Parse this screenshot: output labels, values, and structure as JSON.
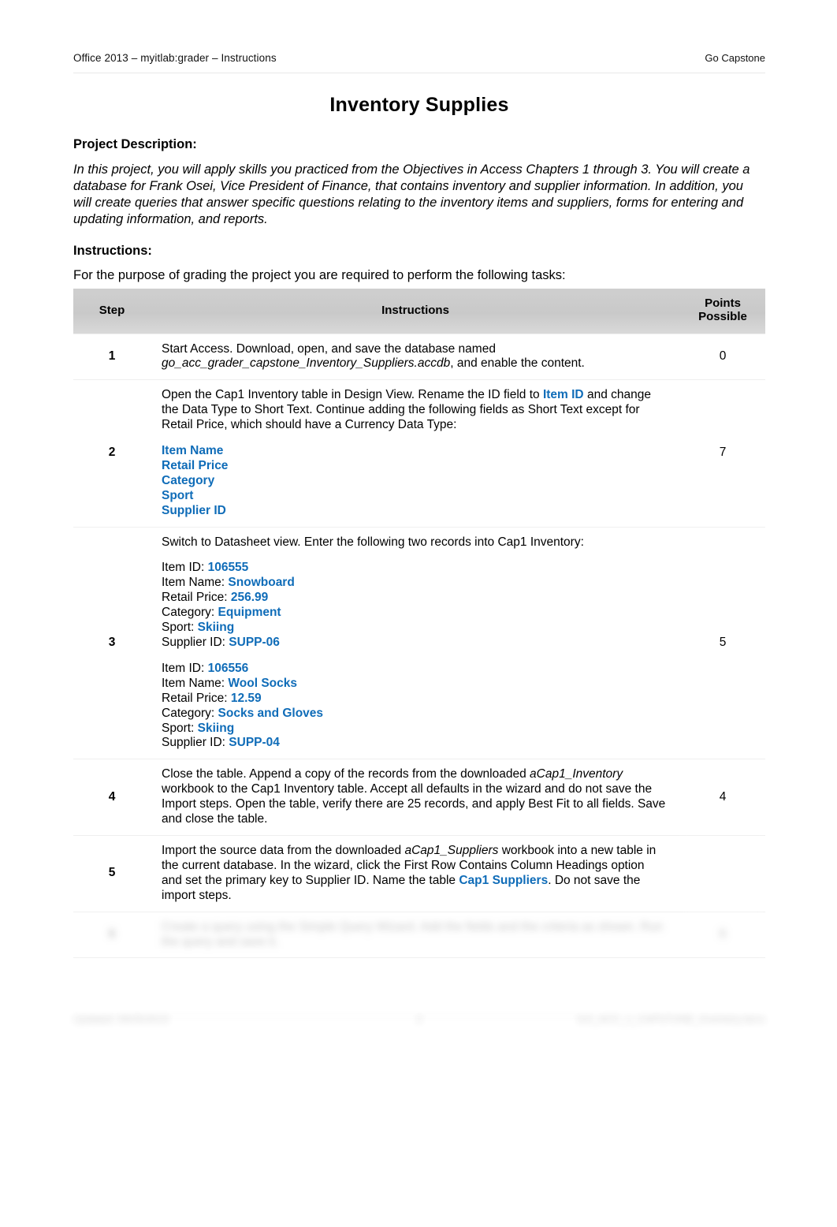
{
  "header": {
    "left": "Office 2013 – myitlab:grader – Instructions",
    "right": "Go Capstone"
  },
  "title": "Inventory Supplies",
  "project_description": {
    "heading": "Project Description:",
    "text": "In this project, you will apply skills you practiced from the Objectives in Access Chapters 1 through 3. You will create a database for Frank Osei, Vice President of Finance, that contains inventory and supplier information. In addition, you will create queries that answer specific questions relating to the inventory items and suppliers, forms for entering and updating information, and reports."
  },
  "instructions": {
    "heading": "Instructions:",
    "intro": "For the purpose of grading the project you are required to perform the following tasks:"
  },
  "table": {
    "columns": {
      "step": "Step",
      "instructions": "Instructions",
      "points_line1": "Points",
      "points_line2": "Possible"
    },
    "rows": [
      {
        "step": "1",
        "points": "0",
        "text_before_file": "Start Access. Download, open, and save the database named ",
        "filename": "go_acc_grader_capstone_Inventory_Suppliers.accdb",
        "text_after_file": ", and enable the content."
      },
      {
        "step": "2",
        "points": "7",
        "intro_a": "Open the Cap1 Inventory table in Design View. Rename the ID field to ",
        "highlight_a": "Item ID",
        "intro_b": " and change the Data Type to Short Text. Continue adding the following fields as Short Text except for Retail Price, which should have a Currency Data Type:",
        "fields": [
          "Item Name",
          "Retail Price",
          "Category",
          "Sport",
          "Supplier ID"
        ]
      },
      {
        "step": "3",
        "points": "5",
        "intro": "Switch to Datasheet view. Enter the following two records into Cap1 Inventory:",
        "records": [
          {
            "Item ID": "106555",
            "Item Name": "Snowboard",
            "Retail Price": "256.99",
            "Category": "Equipment",
            "Sport": "Skiing",
            "Supplier ID": "SUPP-06"
          },
          {
            "Item ID": "106556",
            "Item Name": "Wool Socks",
            "Retail Price": "12.59",
            "Category": "Socks and Gloves",
            "Sport": "Skiing",
            "Supplier ID": "SUPP-04"
          }
        ],
        "record_labels": [
          "Item ID: ",
          "Item Name: ",
          "Retail Price: ",
          "Category: ",
          "Sport: ",
          "Supplier ID: "
        ]
      },
      {
        "step": "4",
        "points": "4",
        "part_a": "Close the table. Append a copy of the records from the downloaded ",
        "filename": "aCap1_Inventory",
        "part_b": " workbook to the Cap1 Inventory table. Accept all defaults in the wizard and do not save the Import steps. Open the table, verify there are 25 records, and apply Best Fit to all fields. Save and close the table."
      },
      {
        "step": "5",
        "points": "",
        "part_a": "Import the source data from the downloaded ",
        "filename": "aCap1_Suppliers",
        "part_b": " workbook into a new table in the current database. In the wizard, click the First Row Contains Column Headings option and set the primary key to Supplier ID. Name the table ",
        "highlight": "Cap1 Suppliers",
        "part_c": ".  Do not save the import steps."
      },
      {
        "step": "6",
        "points": "6",
        "obscured": true,
        "text": "Create a query using the Simple Query Wizard. Add the fields and the criteria as shown. Run the query and save it."
      }
    ]
  },
  "footer": {
    "left": "Updated: 09/25/2015",
    "center": "2",
    "right": "GO_ACC_1_CAPSTONE_Inventory.docx"
  },
  "colors": {
    "accent_blue": "#0f6cb8",
    "header_gray": "#c9c9c9",
    "row_divider": "#efefef"
  }
}
